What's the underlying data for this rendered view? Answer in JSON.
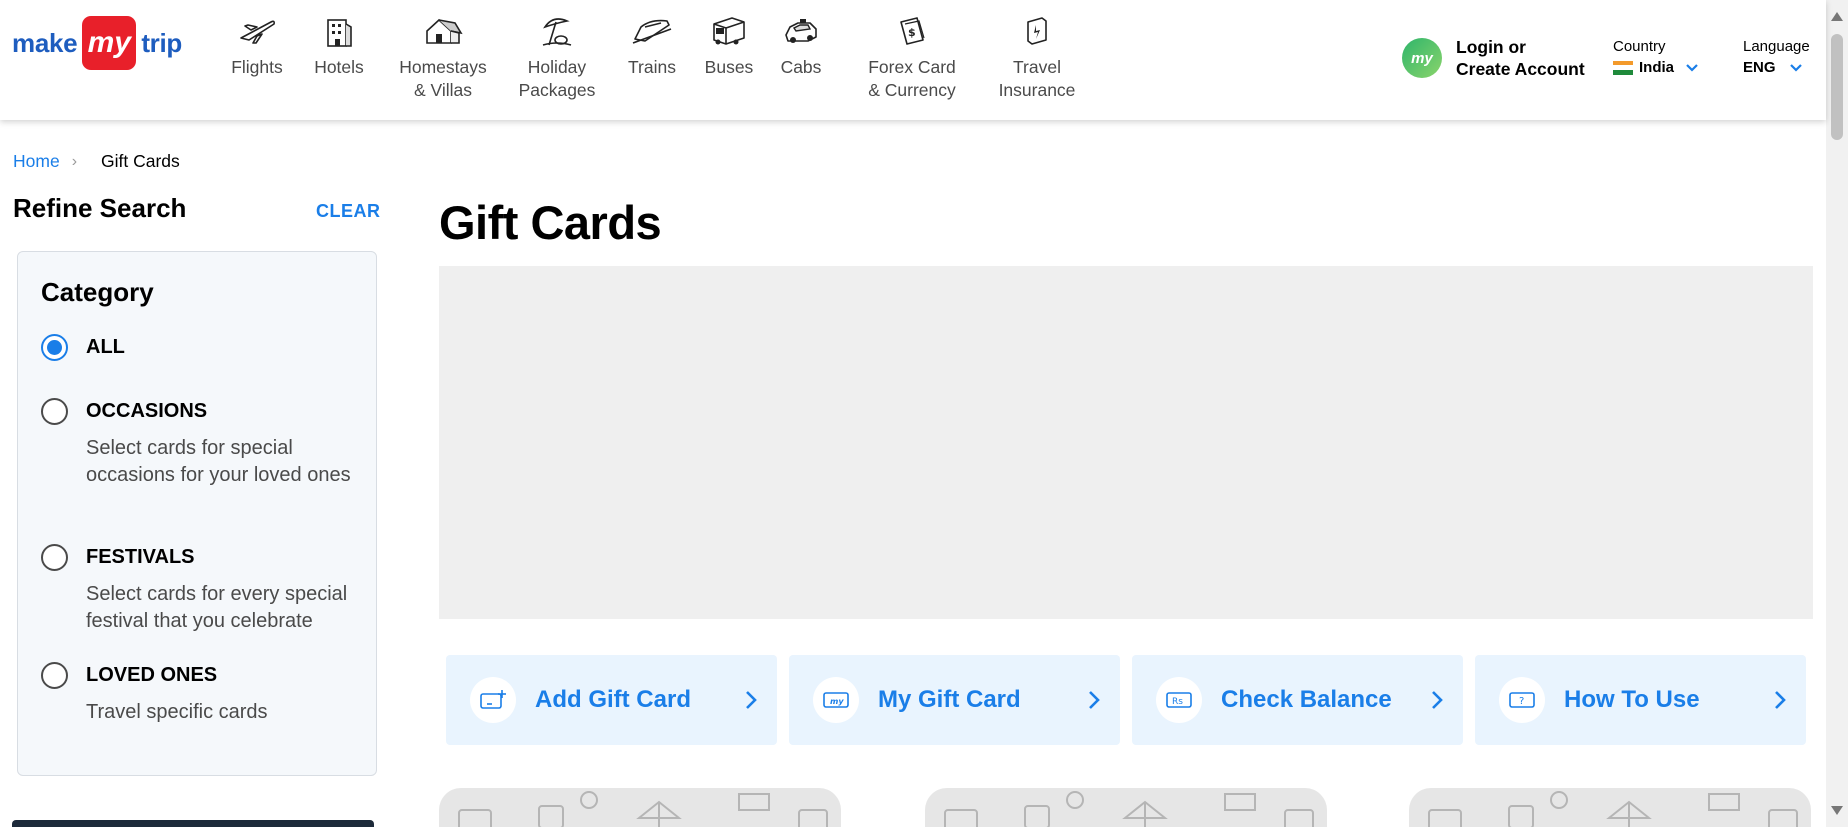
{
  "brand": {
    "word1": "make",
    "badge": "my",
    "word2": "trip",
    "colors": {
      "blue": "#1e5dbf",
      "red": "#e8202a",
      "accent": "#1a7ee8"
    }
  },
  "nav": [
    {
      "label": "Flights",
      "icon": "plane-icon"
    },
    {
      "label": "Hotels",
      "icon": "hotel-icon"
    },
    {
      "label": "Homestays\n& Villas",
      "icon": "homestay-icon"
    },
    {
      "label": "Holiday\nPackages",
      "icon": "holiday-icon"
    },
    {
      "label": "Trains",
      "icon": "train-icon"
    },
    {
      "label": "Buses",
      "icon": "bus-icon"
    },
    {
      "label": "Cabs",
      "icon": "cab-icon"
    },
    {
      "label": "Forex Card\n& Currency",
      "icon": "forex-icon"
    },
    {
      "label": "Travel\nInsurance",
      "icon": "insurance-icon"
    }
  ],
  "login": {
    "avatar_text": "my",
    "label": "Login or\nCreate Account"
  },
  "country": {
    "label": "Country",
    "value": "India"
  },
  "language": {
    "label": "Language",
    "value": "ENG"
  },
  "breadcrumb": {
    "home": "Home",
    "current": "Gift Cards"
  },
  "sidebar": {
    "title": "Refine Search",
    "clear": "CLEAR",
    "category_title": "Category",
    "options": [
      {
        "label": "ALL",
        "desc": "",
        "checked": true
      },
      {
        "label": "OCCASIONS",
        "desc": "Select cards for special occasions for your loved ones",
        "checked": false
      },
      {
        "label": "FESTIVALS",
        "desc": "Select cards for every special festival that you celebrate",
        "checked": false
      },
      {
        "label": "LOVED ONES",
        "desc": "Travel specific cards",
        "checked": false
      }
    ]
  },
  "main": {
    "title": "Gift Cards",
    "actions": [
      {
        "label": "Add Gift Card",
        "icon": "add-card-icon"
      },
      {
        "label": "My Gift Card",
        "icon": "my-card-icon"
      },
      {
        "label": "Check Balance",
        "icon": "rupee-balance-icon"
      },
      {
        "label": "How To Use",
        "icon": "help-icon"
      }
    ]
  }
}
